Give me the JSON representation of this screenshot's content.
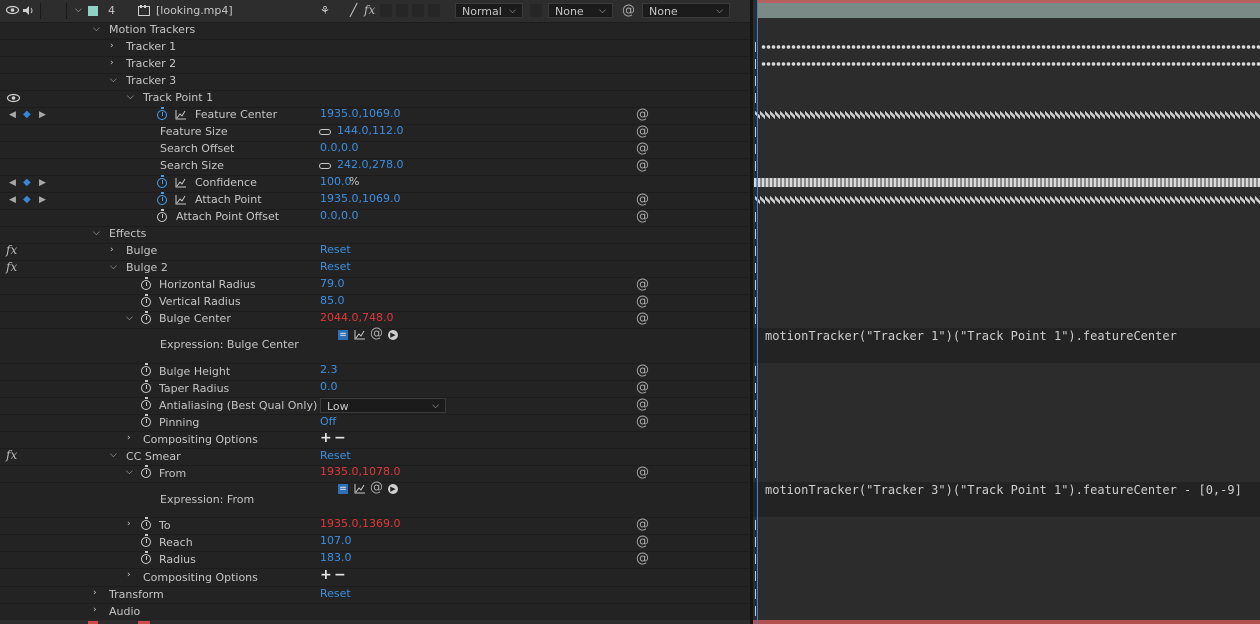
{
  "layer": {
    "number": "4",
    "name": "[looking.mp4]",
    "blend_mode": "Normal",
    "trkmat": "None",
    "parent": "None"
  },
  "rows": [
    {
      "label": "Motion Trackers"
    },
    {
      "label": "Tracker 1"
    },
    {
      "label": "Tracker 2"
    },
    {
      "label": "Tracker 3"
    },
    {
      "label": "Track Point 1"
    },
    {
      "label": "Feature Center",
      "value": "1935.0,1069.0"
    },
    {
      "label": "Feature Size",
      "value": "144.0,112.0"
    },
    {
      "label": "Search Offset",
      "value": "0.0,0.0"
    },
    {
      "label": "Search Size",
      "value": "242.0,278.0"
    },
    {
      "label": "Confidence",
      "value": "100.0",
      "unit": "%"
    },
    {
      "label": "Attach Point",
      "value": "1935.0,1069.0"
    },
    {
      "label": "Attach Point Offset",
      "value": "0.0,0.0"
    },
    {
      "label": "Effects"
    },
    {
      "label": "Bulge",
      "value": "Reset"
    },
    {
      "label": "Bulge 2",
      "value": "Reset"
    },
    {
      "label": "Horizontal Radius",
      "value": "79.0"
    },
    {
      "label": "Vertical Radius",
      "value": "85.0"
    },
    {
      "label": "Bulge Center",
      "value": "2044.0,748.0"
    },
    {
      "label": "Expression: Bulge Center"
    },
    {
      "label": "Bulge Height",
      "value": "2.3"
    },
    {
      "label": "Taper Radius",
      "value": "0.0"
    },
    {
      "label": "Antialiasing (Best Qual Only)",
      "value": "Low"
    },
    {
      "label": "Pinning",
      "value": "Off"
    },
    {
      "label": "Compositing Options"
    },
    {
      "label": "CC Smear",
      "value": "Reset"
    },
    {
      "label": "From",
      "value": "1935.0,1078.0"
    },
    {
      "label": "Expression: From"
    },
    {
      "label": "To",
      "value": "1935.0,1369.0"
    },
    {
      "label": "Reach",
      "value": "107.0"
    },
    {
      "label": "Radius",
      "value": "183.0"
    },
    {
      "label": "Compositing Options"
    },
    {
      "label": "Transform",
      "value": "Reset"
    },
    {
      "label": "Audio"
    }
  ],
  "expressions": {
    "bulge_center": "motionTracker(\"Tracker 1\")(\"Track Point 1\").featureCenter",
    "from": "motionTracker(\"Tracker 3\")(\"Track Point 1\").featureCenter - [0,-9]"
  },
  "colors": {
    "value_blue": "#3c8fe2",
    "expression_red": "#e0383a",
    "label_color": "#8fd1c3"
  },
  "icons": {
    "eye": "eye-icon",
    "speaker": "speaker-icon",
    "stopwatch": "stopwatch-icon",
    "graph": "graph-icon",
    "pickwhip": "pickwhip-icon",
    "link": "link-icon",
    "fx": "fx-icon"
  }
}
